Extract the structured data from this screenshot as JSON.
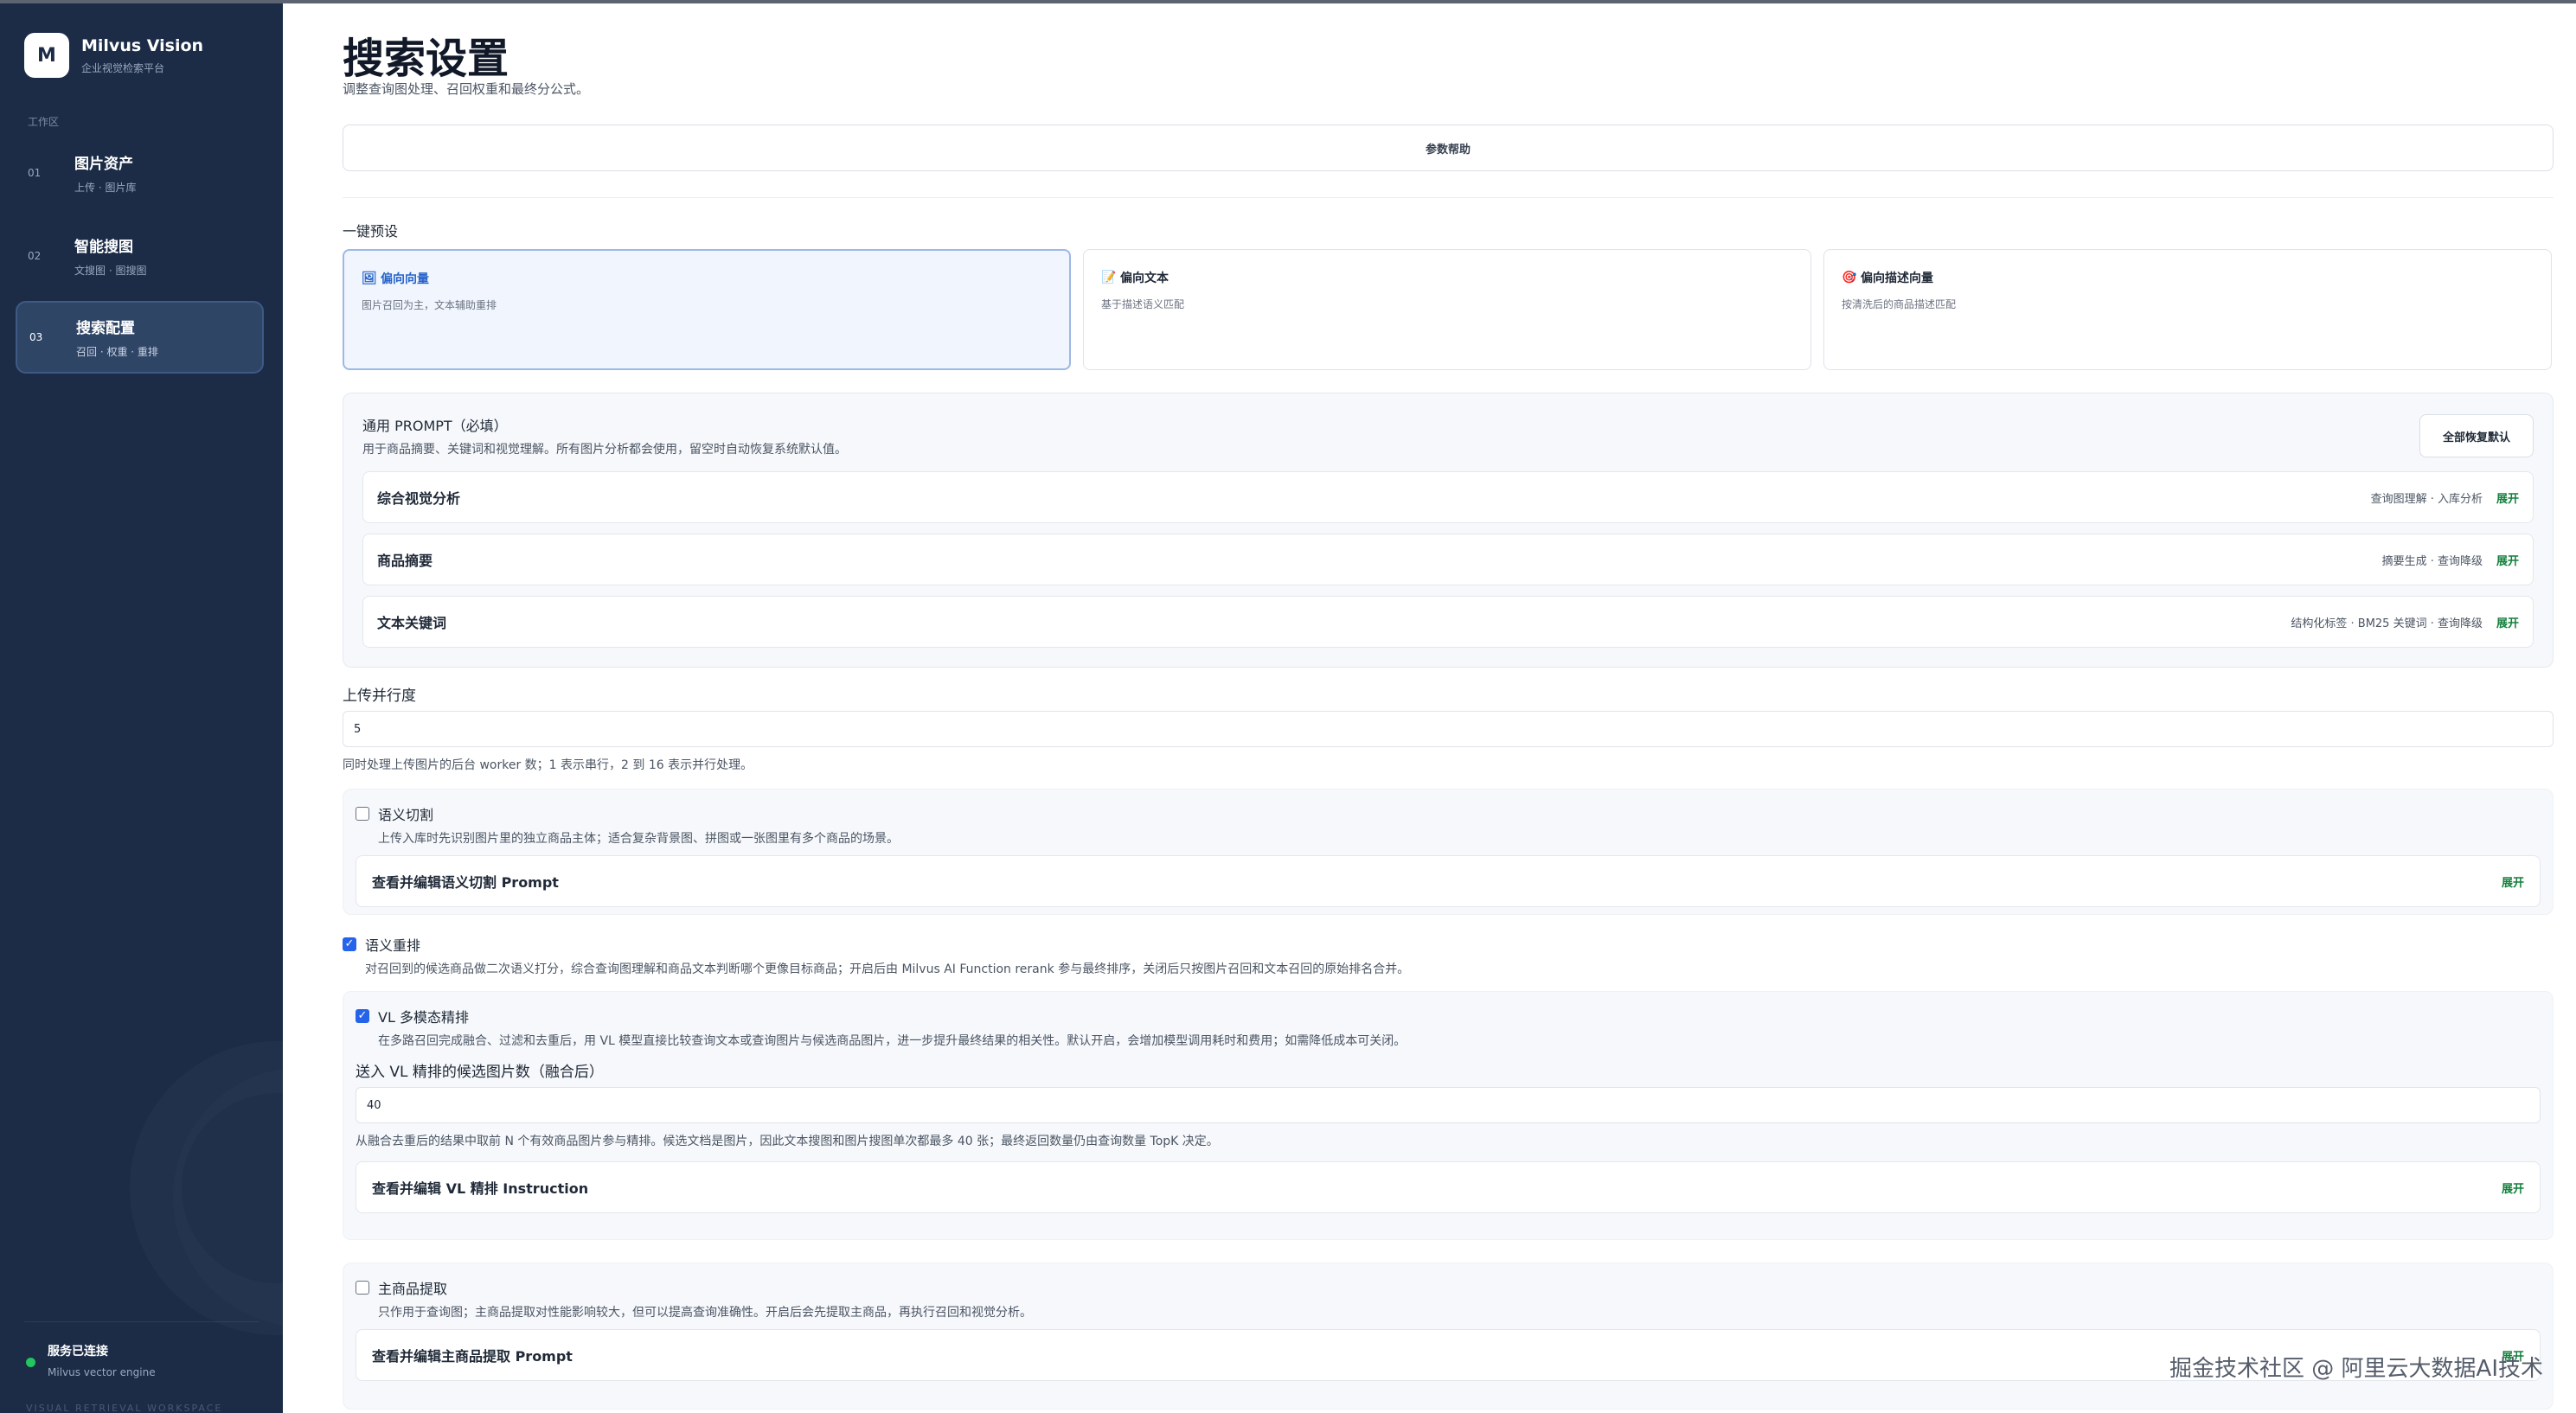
{
  "brand": {
    "logo": "M",
    "title": "Milvus Vision",
    "subtitle": "企业视觉检索平台"
  },
  "sidebar": {
    "section": "工作区",
    "items": [
      {
        "num": "01",
        "title": "图片资产",
        "sub": "上传 · 图片库",
        "active": false
      },
      {
        "num": "02",
        "title": "智能搜图",
        "sub": "文搜图 · 图搜图",
        "active": false
      },
      {
        "num": "03",
        "title": "搜索配置",
        "sub": "召回 · 权重 · 重排",
        "active": true
      }
    ],
    "status_title": "服务已连接",
    "status_sub": "Milvus vector engine",
    "footer": "VISUAL RETRIEVAL WORKSPACE",
    "status_color": "#22c55e"
  },
  "page": {
    "title": "搜索设置",
    "subtitle": "调整查询图处理、召回权重和最终分公式。"
  },
  "help_button": "参数帮助",
  "presets": {
    "label": "一键预设",
    "items": [
      {
        "icon": "image-icon",
        "glyph": "🖼",
        "title": "偏向向量",
        "desc": "图片召回为主，文本辅助重排",
        "active": true
      },
      {
        "icon": "memo-icon",
        "glyph": "📝",
        "title": "偏向文本",
        "desc": "基于描述语义匹配",
        "active": false
      },
      {
        "icon": "target-icon",
        "glyph": "🎯",
        "title": "偏向描述向量",
        "desc": "按清洗后的商品描述匹配",
        "active": false
      }
    ]
  },
  "prompt_section": {
    "title": "通用 PROMPT（必填）",
    "desc": "用于商品摘要、关键词和视觉理解。所有图片分析都会使用，留空时自动恢复系统默认值。",
    "reset_button": "全部恢复默认",
    "rows": [
      {
        "title": "综合视觉分析",
        "meta": "查询图理解 · 入库分析",
        "expand": "展开"
      },
      {
        "title": "商品摘要",
        "meta": "摘要生成 · 查询降级",
        "expand": "展开"
      },
      {
        "title": "文本关键词",
        "meta": "结构化标签 · BM25 关键词 · 查询降级",
        "expand": "展开"
      }
    ]
  },
  "upload": {
    "label": "上传并行度",
    "value": "5",
    "hint": "同时处理上传图片的后台 worker 数；1 表示串行，2 到 16 表示并行处理。"
  },
  "semantic_cut": {
    "label": "语义切割",
    "checked": false,
    "desc": "上传入库时先识别图片里的独立商品主体；适合复杂背景图、拼图或一张图里有多个商品的场景。",
    "row_title": "查看并编辑语义切割 Prompt",
    "expand": "展开"
  },
  "semantic_rerank": {
    "label": "语义重排",
    "checked": true,
    "desc": "对召回到的候选商品做二次语义打分，综合查询图理解和商品文本判断哪个更像目标商品；开启后由 Milvus AI Function rerank 参与最终排序，关闭后只按图片召回和文本召回的原始排名合并。"
  },
  "vl_rerank": {
    "label": "VL 多模态精排",
    "checked": true,
    "desc": "在多路召回完成融合、过滤和去重后，用 VL 模型直接比较查询文本或查询图片与候选商品图片，进一步提升最终结果的相关性。默认开启，会增加模型调用耗时和费用；如需降低成本可关闭。",
    "count_label": "送入 VL 精排的候选图片数（融合后）",
    "count_value": "40",
    "count_hint": "从融合去重后的结果中取前 N 个有效商品图片参与精排。候选文档是图片，因此文本搜图和图片搜图单次都最多 40 张；最终返回数量仍由查询数量 TopK 决定。",
    "row_title": "查看并编辑 VL 精排 Instruction",
    "expand": "展开"
  },
  "main_product": {
    "label": "主商品提取",
    "checked": false,
    "desc": "只作用于查询图；主商品提取对性能影响较大，但可以提高查询准确性。开启后会先提取主商品，再执行召回和视觉分析。",
    "row_title": "查看并编辑主商品提取 Prompt",
    "expand": "展开"
  },
  "watermark": "掘金技术社区 @ 阿里云大数据AI技术",
  "colors": {
    "sidebar_bg": "#1c2c47",
    "accent_blue": "#2563eb",
    "expand_green": "#15803d"
  }
}
